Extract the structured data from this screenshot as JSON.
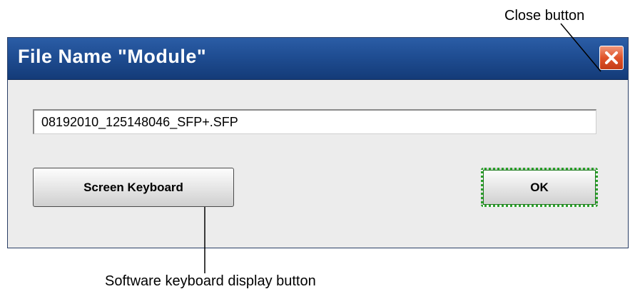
{
  "dialog": {
    "title": "File Name \"Module\"",
    "close_icon": "close-x-icon",
    "filename_value": "08192010_125148046_SFP+.SFP",
    "keyboard_button_label": "Screen Keyboard",
    "ok_button_label": "OK"
  },
  "annotations": {
    "close_label": "Close button",
    "keyboard_label": "Software keyboard display button"
  },
  "colors": {
    "titlebar": "#1f4d92",
    "close_button": "#e0532a",
    "ok_focus": "#2aa02a",
    "dialog_body": "#ececec"
  }
}
